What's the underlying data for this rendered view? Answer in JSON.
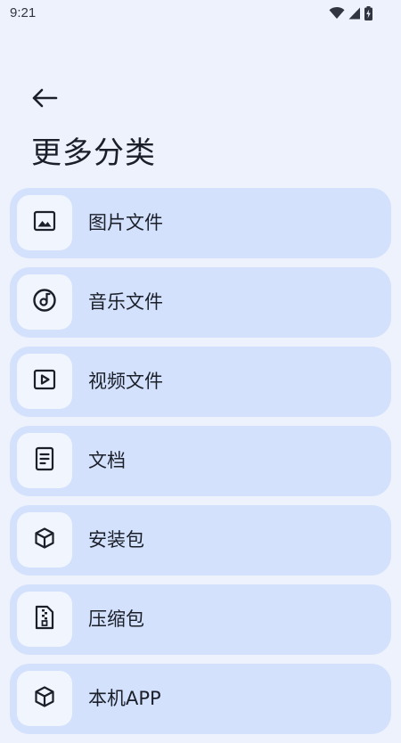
{
  "status_bar": {
    "time": "9:21",
    "icons": [
      "wifi-icon",
      "signal-icon",
      "battery-icon"
    ]
  },
  "header": {
    "back_icon": "arrow-left-icon",
    "title": "更多分类"
  },
  "categories": [
    {
      "label": "图片文件",
      "icon": "image-icon"
    },
    {
      "label": "音乐文件",
      "icon": "music-disc-icon"
    },
    {
      "label": "视频文件",
      "icon": "video-play-icon"
    },
    {
      "label": "文档",
      "icon": "document-icon"
    },
    {
      "label": "安装包",
      "icon": "package-cube-icon"
    },
    {
      "label": "压缩包",
      "icon": "zip-archive-icon"
    },
    {
      "label": "本机APP",
      "icon": "app-cube-icon"
    }
  ],
  "colors": {
    "background": "#eef2fc",
    "card": "#d3e1fc",
    "icon_box": "#f1f5fe",
    "text": "#1b1f2a"
  }
}
